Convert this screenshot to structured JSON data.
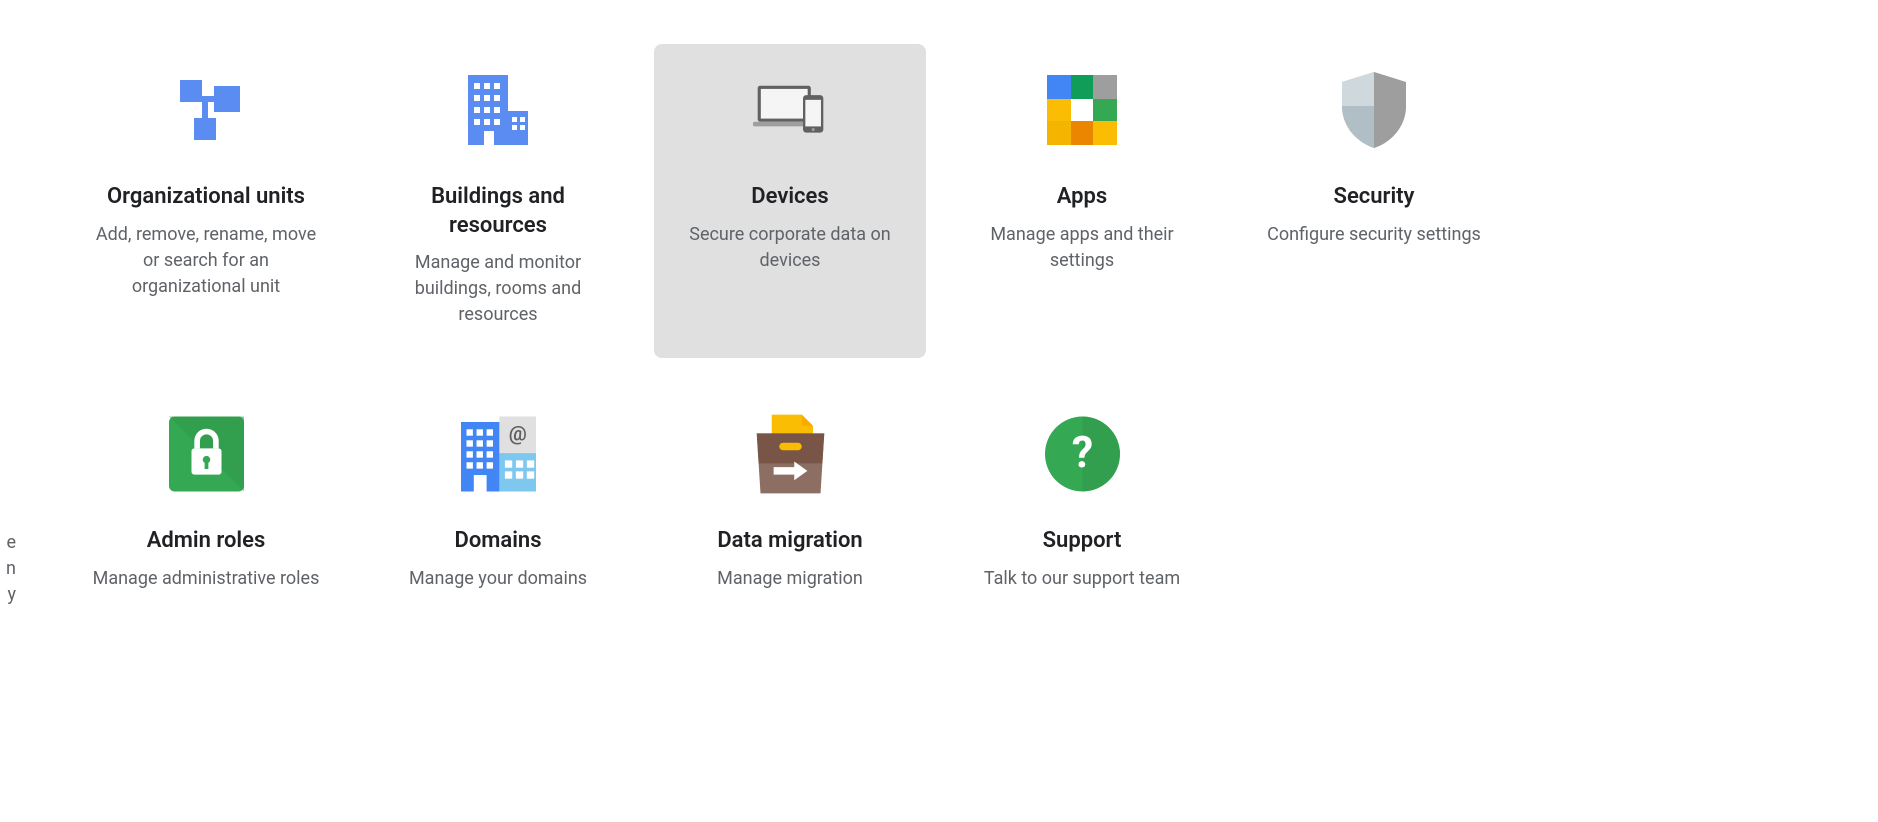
{
  "cards": [
    {
      "title": "Organizational units",
      "desc": "Add, remove, rename, move or search for an organizational unit"
    },
    {
      "title": "Buildings and resources",
      "desc": "Manage and monitor buildings, rooms and resources"
    },
    {
      "title": "Devices",
      "desc": "Secure corporate data on devices"
    },
    {
      "title": "Apps",
      "desc": "Manage apps and their settings"
    },
    {
      "title": "Security",
      "desc": "Configure security settings"
    },
    {
      "title": "Admin roles",
      "desc": "Manage administrative roles"
    },
    {
      "title": "Domains",
      "desc": "Manage your domains"
    },
    {
      "title": "Data migration",
      "desc": "Manage migration"
    },
    {
      "title": "Support",
      "desc": "Talk to our support team"
    }
  ],
  "edge": {
    "line1": "e",
    "line2": "n",
    "line3": "y"
  }
}
